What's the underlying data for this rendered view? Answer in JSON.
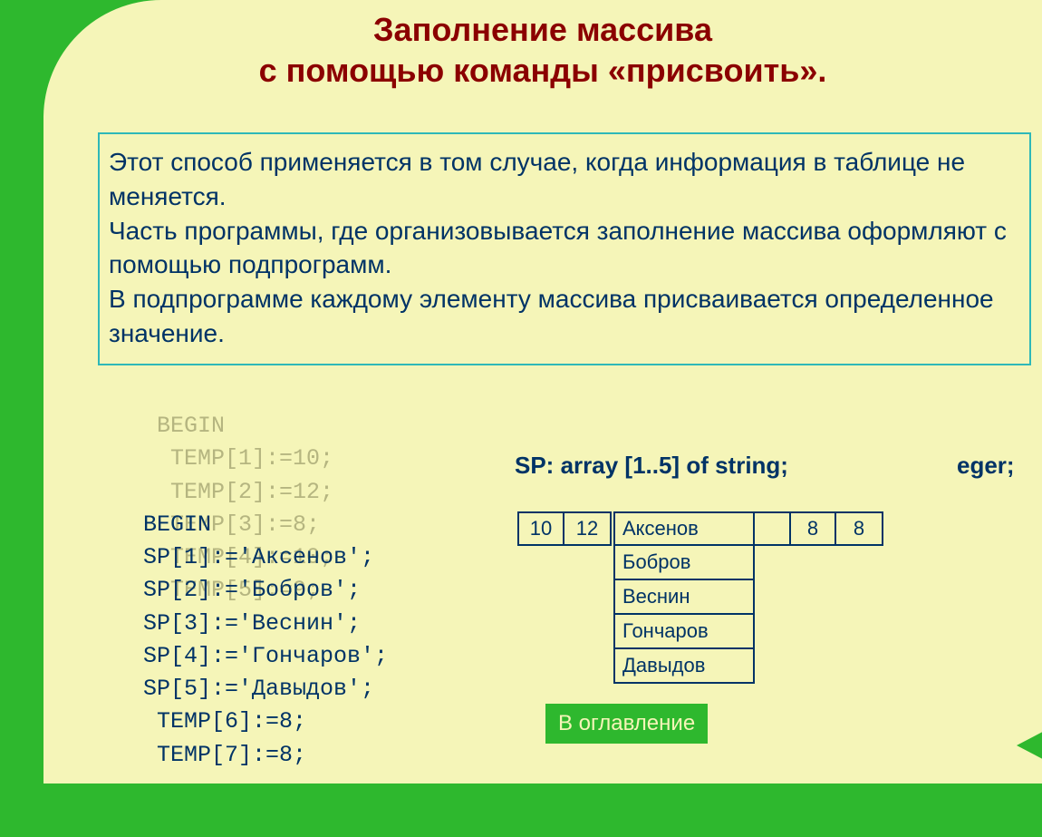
{
  "title_line1": "Заполнение массива",
  "title_line2": "с  помощью команды «присвоить».",
  "info_p1": "Этот способ применяется в том случае, когда информация в таблице не меняется.",
  "info_p2": "Часть программы, где организовывается заполнение массива оформляют с помощью подпрограмм.",
  "info_p3": "В подпрограмме  каждому элементу массива присваивается определенное значение.",
  "code_bg": " BEGIN\n  TEMP[1]:=10;\n  TEMP[2]:=12;\n  TEMP[3]:=8;\n  TEMP[4]:=10;\n  TEMP[5]:=9;",
  "code_fg": "BEGIN\nSP[1]:='Аксенов';\nSP[2]:='Бобров';\nSP[3]:='Веснин';\nSP[4]:='Гончаров';\nSP[5]:='Давыдов';\n TEMP[6]:=8;\n TEMP[7]:=8;",
  "array_decl": "SP:  array [1..5] of string;",
  "array_decl_ghost": "eger;",
  "table": {
    "row_nums_left": [
      "10",
      "12"
    ],
    "row_nums_right": [
      "8",
      "8"
    ],
    "dropdown": [
      "Аксенов",
      "Бобров",
      "Веснин",
      "Гончаров",
      "Давыдов"
    ]
  },
  "toc_label": "В оглавление"
}
